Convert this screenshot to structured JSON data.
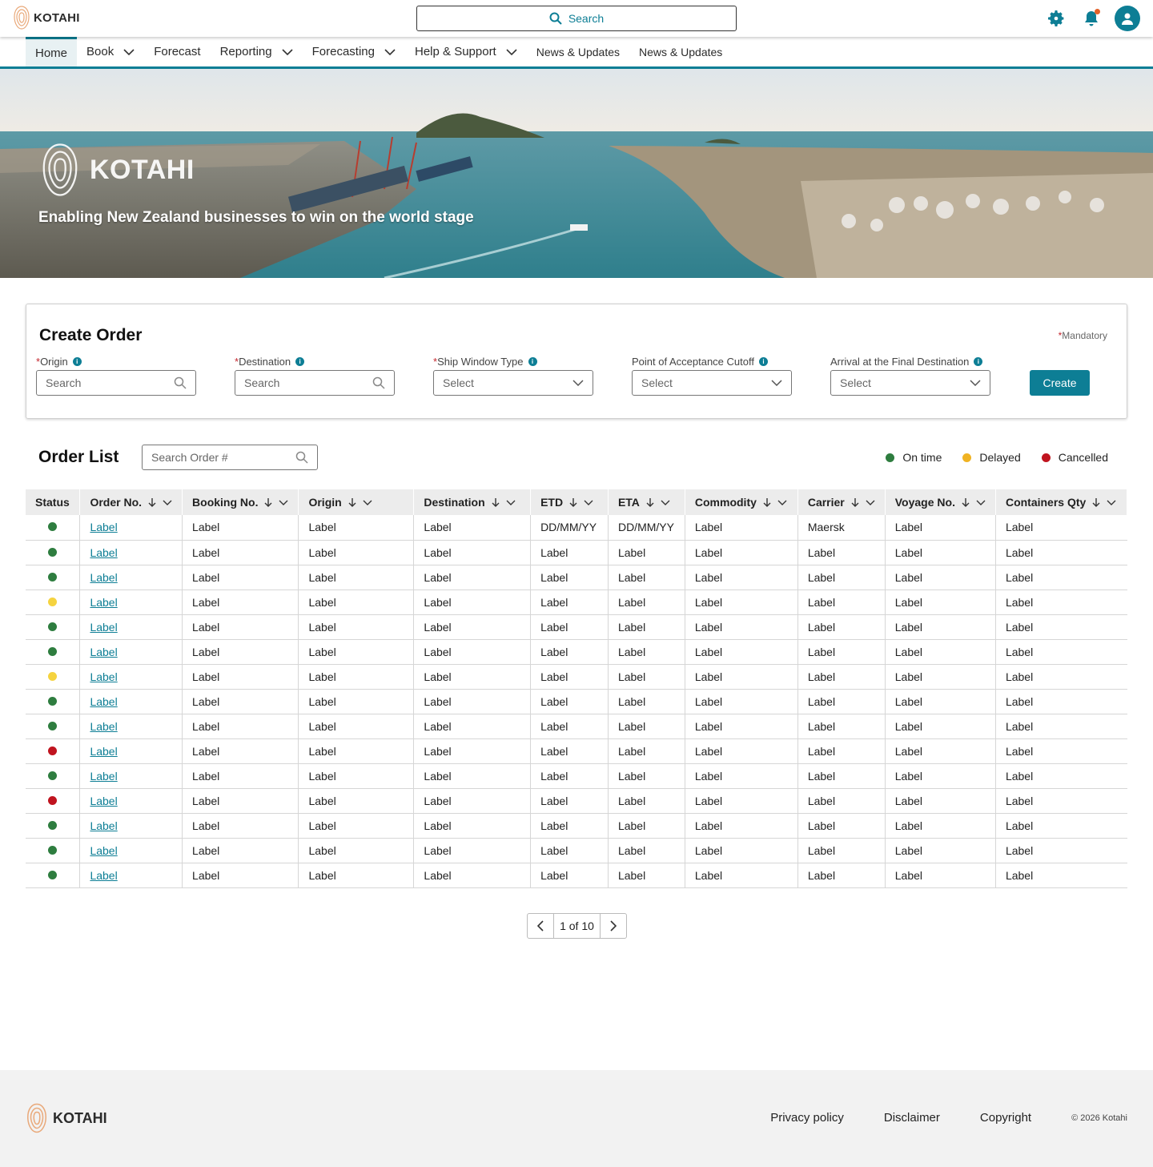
{
  "brand": {
    "name": "KOTAHI"
  },
  "top": {
    "search_placeholder": "Search"
  },
  "nav": {
    "items": [
      {
        "label": "Home"
      },
      {
        "label": "Book"
      },
      {
        "label": "Forecast"
      },
      {
        "label": "Reporting"
      },
      {
        "label": "Forecasting"
      },
      {
        "label": "Help & Support"
      },
      {
        "label": "News & Updates"
      },
      {
        "label": "News & Updates"
      }
    ]
  },
  "hero": {
    "logo_text": "KOTAHI",
    "tagline": "Enabling New Zealand businesses to win on the world stage"
  },
  "create_order": {
    "title": "Create Order",
    "mandatory_label": "Mandatory",
    "fields": [
      {
        "label": "Origin",
        "required": true,
        "value": "Search",
        "kind": "search"
      },
      {
        "label": "Destination",
        "required": true,
        "value": "Search",
        "kind": "search"
      },
      {
        "label": "Ship Window Type",
        "required": true,
        "value": "Select",
        "kind": "select"
      },
      {
        "label": "Point of Acceptance Cutoff",
        "required": false,
        "value": "Select",
        "kind": "select"
      },
      {
        "label": "Arrival at the Final Destination",
        "required": false,
        "value": "Select",
        "kind": "select"
      }
    ],
    "create_label": "Create"
  },
  "order_list": {
    "title": "Order List",
    "search_placeholder": "Search Order #",
    "legend": [
      {
        "label": "On time",
        "color": "#2e7d3f"
      },
      {
        "label": "Delayed",
        "color": "#f0b323"
      },
      {
        "label": "Cancelled",
        "color": "#c0141f"
      }
    ],
    "columns": [
      "Status",
      "Order No.",
      "Booking No.",
      "Origin",
      "Destination",
      "ETD",
      "ETA",
      "Commodity",
      "Carrier",
      "Voyage No.",
      "Containers Qty"
    ],
    "rows": [
      {
        "status": "#2e7d3f",
        "cells": [
          "Label",
          "Label",
          "Label",
          "Label",
          "DD/MM/YY",
          "DD/MM/YY",
          "Label",
          "Maersk",
          "Label",
          "Label"
        ]
      },
      {
        "status": "#2e7d3f",
        "cells": [
          "Label",
          "Label",
          "Label",
          "Label",
          "Label",
          "Label",
          "Label",
          "Label",
          "Label",
          "Label"
        ]
      },
      {
        "status": "#2e7d3f",
        "cells": [
          "Label",
          "Label",
          "Label",
          "Label",
          "Label",
          "Label",
          "Label",
          "Label",
          "Label",
          "Label"
        ]
      },
      {
        "status": "#f5d33f",
        "cells": [
          "Label",
          "Label",
          "Label",
          "Label",
          "Label",
          "Label",
          "Label",
          "Label",
          "Label",
          "Label"
        ]
      },
      {
        "status": "#2e7d3f",
        "cells": [
          "Label",
          "Label",
          "Label",
          "Label",
          "Label",
          "Label",
          "Label",
          "Label",
          "Label",
          "Label"
        ]
      },
      {
        "status": "#2e7d3f",
        "cells": [
          "Label",
          "Label",
          "Label",
          "Label",
          "Label",
          "Label",
          "Label",
          "Label",
          "Label",
          "Label"
        ]
      },
      {
        "status": "#f5d33f",
        "cells": [
          "Label",
          "Label",
          "Label",
          "Label",
          "Label",
          "Label",
          "Label",
          "Label",
          "Label",
          "Label"
        ]
      },
      {
        "status": "#2e7d3f",
        "cells": [
          "Label",
          "Label",
          "Label",
          "Label",
          "Label",
          "Label",
          "Label",
          "Label",
          "Label",
          "Label"
        ]
      },
      {
        "status": "#2e7d3f",
        "cells": [
          "Label",
          "Label",
          "Label",
          "Label",
          "Label",
          "Label",
          "Label",
          "Label",
          "Label",
          "Label"
        ]
      },
      {
        "status": "#c0141f",
        "cells": [
          "Label",
          "Label",
          "Label",
          "Label",
          "Label",
          "Label",
          "Label",
          "Label",
          "Label",
          "Label"
        ]
      },
      {
        "status": "#2e7d3f",
        "cells": [
          "Label",
          "Label",
          "Label",
          "Label",
          "Label",
          "Label",
          "Label",
          "Label",
          "Label",
          "Label"
        ]
      },
      {
        "status": "#c0141f",
        "cells": [
          "Label",
          "Label",
          "Label",
          "Label",
          "Label",
          "Label",
          "Label",
          "Label",
          "Label",
          "Label"
        ]
      },
      {
        "status": "#2e7d3f",
        "cells": [
          "Label",
          "Label",
          "Label",
          "Label",
          "Label",
          "Label",
          "Label",
          "Label",
          "Label",
          "Label"
        ]
      },
      {
        "status": "#2e7d3f",
        "cells": [
          "Label",
          "Label",
          "Label",
          "Label",
          "Label",
          "Label",
          "Label",
          "Label",
          "Label",
          "Label"
        ]
      },
      {
        "status": "#2e7d3f",
        "cells": [
          "Label",
          "Label",
          "Label",
          "Label",
          "Label",
          "Label",
          "Label",
          "Label",
          "Label",
          "Label"
        ]
      }
    ],
    "pagination": "1 of 10"
  },
  "footer": {
    "brand": "KOTAHI",
    "links": [
      "Privacy policy",
      "Disclaimer",
      "Copyright"
    ],
    "copyright": "© 2026 Kotahi"
  },
  "colors": {
    "accent": "#0d7e95"
  }
}
